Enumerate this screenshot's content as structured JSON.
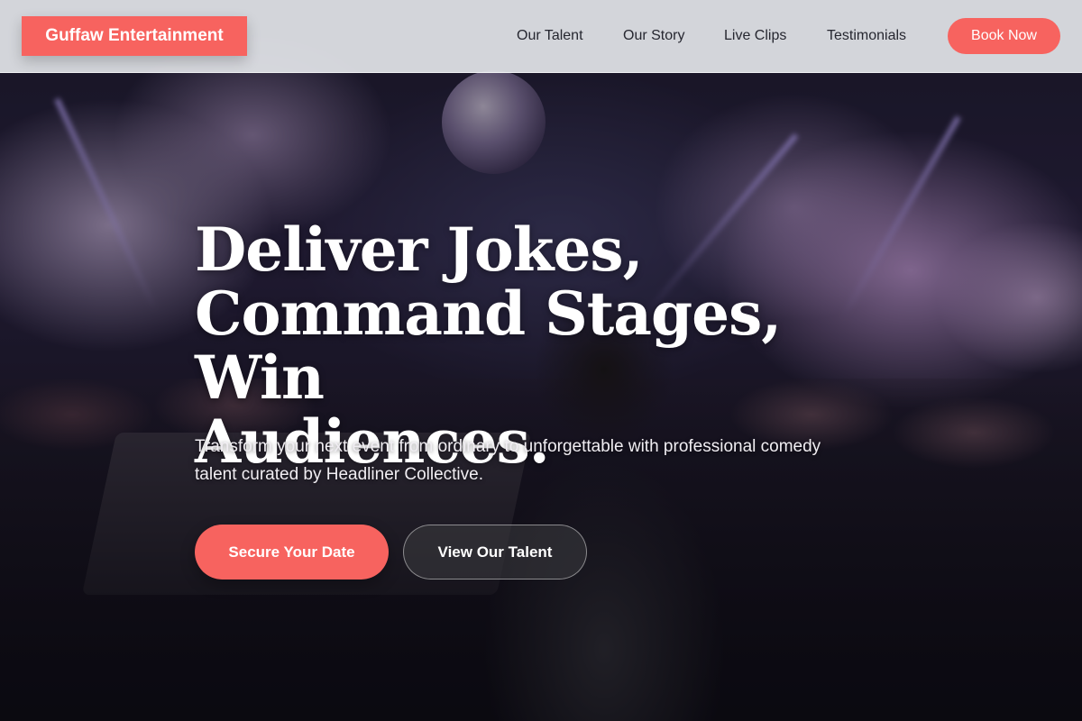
{
  "header": {
    "brand": "Guffaw Entertainment",
    "nav": [
      {
        "label": "Our Talent"
      },
      {
        "label": "Our Story"
      },
      {
        "label": "Live Clips"
      },
      {
        "label": "Testimonials"
      }
    ],
    "cta_label": "Book Now"
  },
  "hero": {
    "headline_lines": [
      "Deliver Jokes,",
      "Command Stages, Win",
      "Audiences."
    ],
    "subtext": "Transform your next event from ordinary to unforgettable with professional comedy talent curated by Headliner Collective.",
    "primary_cta": "Secure Your Date",
    "secondary_cta": "View Our Talent"
  },
  "colors": {
    "accent": "#f7635f",
    "header_bg": "#e2e4e8",
    "nav_text": "#262730"
  }
}
